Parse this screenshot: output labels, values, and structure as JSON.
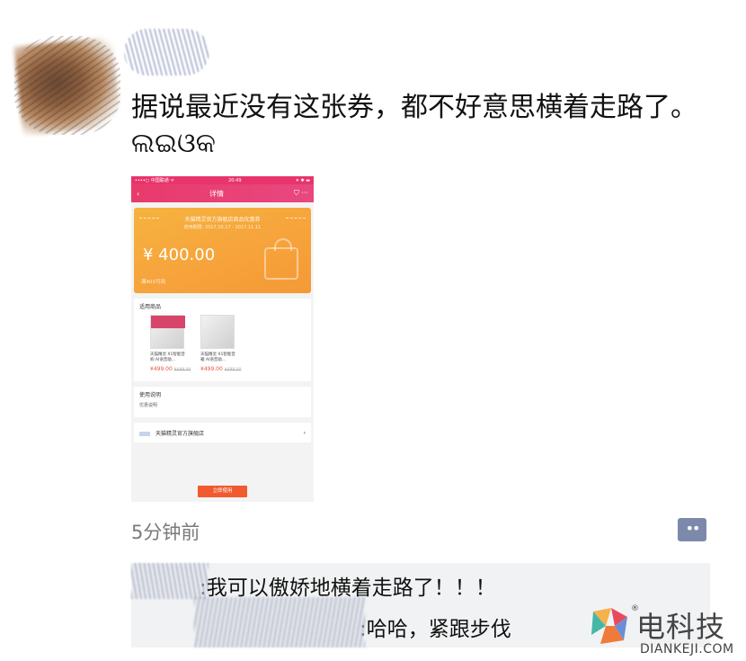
{
  "post": {
    "text": "据说最近没有这张券，都不好意思横着走路了。ଲଇଓକ",
    "time": "5分钟前"
  },
  "screenshot": {
    "statusbar": {
      "carrier": "••••○ 中国联通 ᯤ",
      "time": "20:49",
      "icons": "⁕ ✱ ▬"
    },
    "navbar": {
      "back": "‹",
      "title": "详情",
      "icons": "⛉  ···"
    },
    "coupon": {
      "title": "天猫精灵官方旗舰店商品优惠券",
      "date": "使用期限: 2017.10.17 - 2017.11.11",
      "amount": "¥ 400.00",
      "condition": "满401可用"
    },
    "products": {
      "heading": "适用商品",
      "items": [
        {
          "name": "天猫精灵 X1智能音响 AI语音助...",
          "price": "¥499.00",
          "old_price": "¥499.00"
        },
        {
          "name": "天猫精灵 X1智能音箱 AI语音助...",
          "price": "¥499.00",
          "old_price": "¥499.00"
        }
      ]
    },
    "usage": {
      "heading": "使用说明",
      "body": "优惠说明"
    },
    "shop": {
      "name": "天猫精灵官方旗舰店",
      "chevron": "›"
    },
    "use_button": "立即使用"
  },
  "comments": [
    {
      "colon": ":",
      "text": "我可以傲娇地横着走路了！！！"
    },
    {
      "colon": ":",
      "text": "哈哈，紧跟步伐"
    }
  ],
  "comment_button": "••",
  "watermark": {
    "brand": "电科技",
    "reg": "®",
    "domain": "DIANKEJI.COM"
  },
  "colors": {
    "coupon": "#f7a23b",
    "navbar": "#e8487f",
    "use_button": "#f05a2e",
    "comment_button": "#7d89ab"
  }
}
